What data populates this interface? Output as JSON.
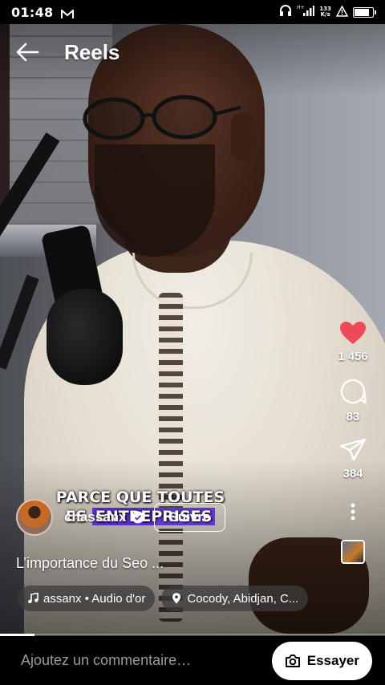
{
  "status_bar": {
    "time": "01:48",
    "net_speed_value": "133",
    "net_speed_unit": "K/s",
    "network_type": "H+",
    "battery_level": 0.85
  },
  "header": {
    "title": "Reels"
  },
  "video": {
    "caption_line1": "PARCE QUE TOUTES",
    "caption_line2_prefix": "ES ",
    "caption_line2_highlight": "ENTREPRISES"
  },
  "actions": {
    "likes": "1 456",
    "comments": "83",
    "shares": "384",
    "like_color": "#ed4956"
  },
  "author": {
    "username": "chassanx",
    "follow_label": "Suivre"
  },
  "post": {
    "description": "L’importance du Seo ...",
    "audio_label": "assanx • Audio d'or",
    "location_label": "Cocody, Abidjan, C..."
  },
  "playback": {
    "progress": 0.09
  },
  "comment_bar": {
    "placeholder": "Ajoutez un commentaire…",
    "try_label": "Essayer"
  }
}
